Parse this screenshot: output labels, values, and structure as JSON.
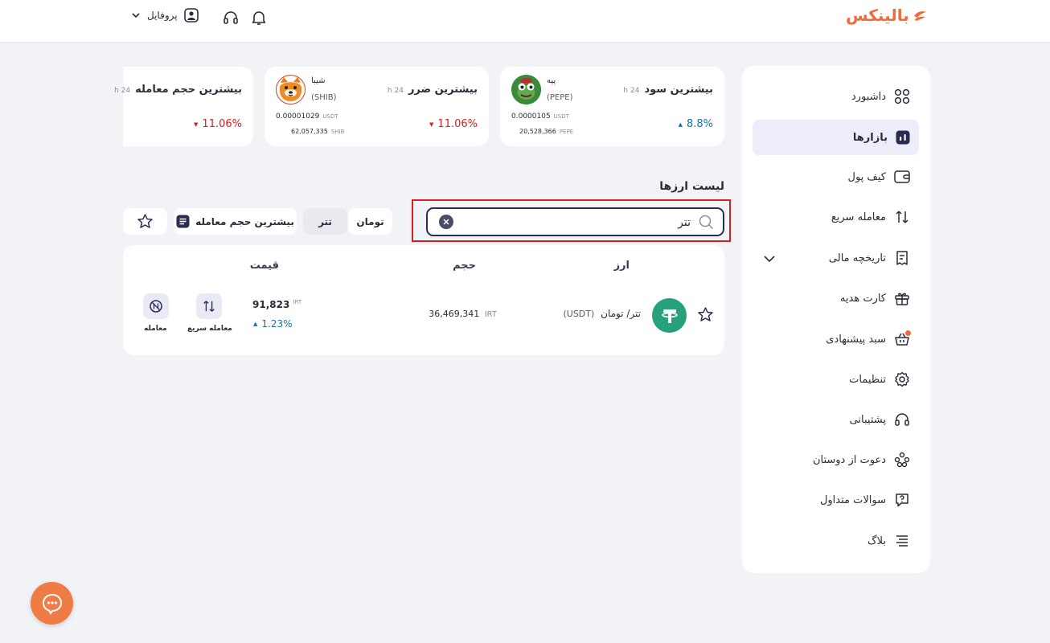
{
  "header": {
    "logo_text": "بالینکس",
    "profile_label": "پروفایل"
  },
  "sidebar": {
    "items": [
      {
        "label": "داشبورد",
        "icon": "grid-icon"
      },
      {
        "label": "بازارها",
        "icon": "market-icon",
        "active": true
      },
      {
        "label": "کیف پول",
        "icon": "wallet-icon"
      },
      {
        "label": "معامله سریع",
        "icon": "swap-icon"
      },
      {
        "label": "تاریخچه مالی",
        "icon": "receipt-icon"
      },
      {
        "label": "کارت هدیه",
        "icon": "gift-icon"
      },
      {
        "label": "سبد پیشنهادی",
        "icon": "basket-icon"
      },
      {
        "label": "تنظیمات",
        "icon": "gear-icon"
      },
      {
        "label": "پشتیبانی",
        "icon": "headset-icon"
      },
      {
        "label": "دعوت از دوستان",
        "icon": "invite-icon"
      },
      {
        "label": "سوالات متداول",
        "icon": "faq-icon"
      },
      {
        "label": "بلاگ",
        "icon": "blog-icon"
      }
    ]
  },
  "stats": {
    "gainer": {
      "title": "بیشترین سود",
      "period": "24 h",
      "coin_name": "پپه",
      "coin_symbol": "(PEPE)",
      "price": "0.0000105",
      "price_unit": "USDT",
      "volume": "20,528,366",
      "volume_unit": "PEPE",
      "change": "8.8%"
    },
    "loser": {
      "title": "بیشترین ضرر",
      "period": "24 h",
      "coin_name": "شیبا",
      "coin_symbol": "(SHIB)",
      "price": "0.00001029",
      "price_unit": "USDT",
      "volume": "62,057,335",
      "volume_unit": "SHIB",
      "change": "11.06%"
    },
    "volume": {
      "title": "بیشترین حجم معامله",
      "period": "24 h",
      "change": "11.06%"
    }
  },
  "list": {
    "title": "لیست ارزها",
    "search_value": "تتر",
    "filters": {
      "toman": "تومان",
      "tether": "تتر",
      "sort": "بیشترین حجم معامله"
    },
    "columns": {
      "currency": "ارز",
      "volume": "حجم",
      "price": "قیمت"
    },
    "rows": [
      {
        "name": "تتر/ تومان",
        "symbol": "(USDT)",
        "volume": "36,469,341",
        "volume_unit": "IRT",
        "price": "91,823",
        "price_unit": "IRT",
        "change": "1.23%",
        "quick_trade": "معامله سریع",
        "trade": "معامله"
      }
    ]
  },
  "colors": {
    "brand": "#ef6c3a",
    "up": "#1d6fa8",
    "down": "#d62020",
    "tether": "#26a17b",
    "highlight": "#d62020"
  }
}
